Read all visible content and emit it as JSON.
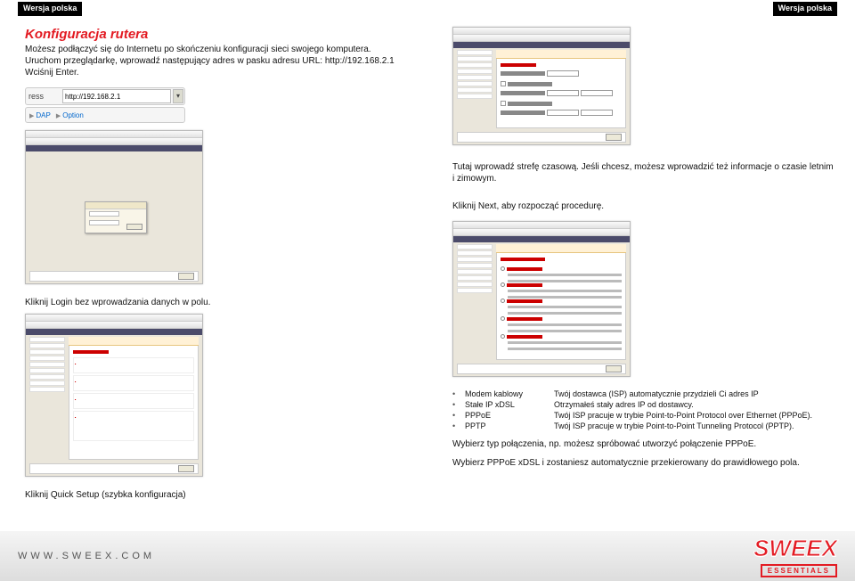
{
  "header": {
    "version_left": "Wersja polska",
    "version_right": "Wersja polska"
  },
  "left": {
    "title": "Konfiguracja rutera",
    "p1": "Możesz podłączyć się do Internetu po skończeniu konfiguracji sieci swojego komputera.",
    "p2": "Uruchom przeglądarkę, wprowadź następujący adres w pasku adresu URL: http://192.168.2.1",
    "p3": "Wciśnij Enter.",
    "addr_label": "ress",
    "addr_value": "http://192.168.2.1",
    "addr_links": {
      "dap": "DAP",
      "options": "Option"
    },
    "cap_login": "Kliknij Login bez wprowadzania danych w polu.",
    "cap_quick": "Kliknij Quick Setup (szybka konfiguracja)"
  },
  "right": {
    "p_timezone": "Tutaj wprowadź strefę czasową. Jeśli chcesz, możesz wprowadzić też informacje o czasie letnim i zimowym.",
    "p_next": "Kliknij Next, aby rozpocząć procedurę.",
    "conn_types": [
      {
        "name": "Modem kablowy",
        "desc": "Twój dostawca (ISP) automatycznie przydzieli Ci adres IP"
      },
      {
        "name": "Stałe IP xDSL",
        "desc": "Otrzymałeś stały adres IP od dostawcy."
      },
      {
        "name": "PPPoE",
        "desc": "Twój ISP pracuje w trybie Point-to-Point Protocol over Ethernet (PPPoE)."
      },
      {
        "name": "PPTP",
        "desc": "Twój ISP pracuje w trybie Point-to-Point Tunneling Protocol (PPTP)."
      }
    ],
    "p_choose": "Wybierz typ połączenia, np. możesz spróbować utworzyć połączenie PPPoE.",
    "p_ppp": "Wybierz PPPoE xDSL i zostaniesz automatycznie przekierowany do prawidłowego pola."
  },
  "footer": {
    "url": "WWW.SWEEX.COM",
    "brand": "SWEEX",
    "tag": "ESSENTIALS"
  }
}
